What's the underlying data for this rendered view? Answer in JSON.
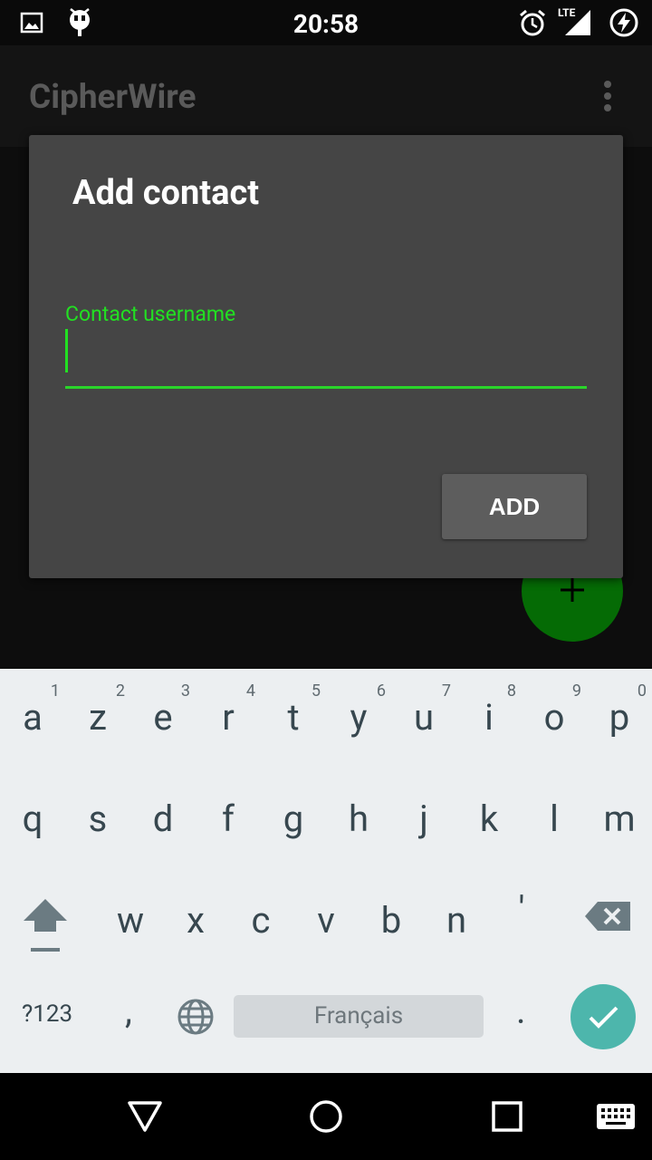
{
  "status_bar": {
    "time": "20:58",
    "icons": [
      "image-icon",
      "cyanogenmod-icon",
      "alarm-icon",
      "lte-signal-icon",
      "battery-charging-icon"
    ],
    "network": "LTE"
  },
  "app": {
    "title": "CipherWire",
    "menu_icon": "more-vert-icon",
    "fab_icon": "plus-icon"
  },
  "dialog": {
    "title": "Add contact",
    "field_label": "Contact username",
    "field_value": "",
    "add_label": "ADD"
  },
  "keyboard": {
    "row1": [
      {
        "ch": "a",
        "hint": "1"
      },
      {
        "ch": "z",
        "hint": "2"
      },
      {
        "ch": "e",
        "hint": "3"
      },
      {
        "ch": "r",
        "hint": "4"
      },
      {
        "ch": "t",
        "hint": "5"
      },
      {
        "ch": "y",
        "hint": "6"
      },
      {
        "ch": "u",
        "hint": "7"
      },
      {
        "ch": "i",
        "hint": "8"
      },
      {
        "ch": "o",
        "hint": "9"
      },
      {
        "ch": "p",
        "hint": "0"
      }
    ],
    "row2": [
      "q",
      "s",
      "d",
      "f",
      "g",
      "h",
      "j",
      "k",
      "l",
      "m"
    ],
    "row3": [
      "w",
      "x",
      "c",
      "v",
      "b",
      "n",
      "'"
    ],
    "symbols_label": "?123",
    "comma": ",",
    "space_label": "Français",
    "period": ".",
    "colors": {
      "enter": "#4db6ac",
      "background": "#eceff1"
    }
  },
  "nav_bar": {
    "icons": [
      "back-icon",
      "home-icon",
      "recents-icon",
      "keyboard-switch-icon"
    ]
  },
  "colors": {
    "accent": "#22e022",
    "dialog": "#454545",
    "fab": "#056b05"
  }
}
